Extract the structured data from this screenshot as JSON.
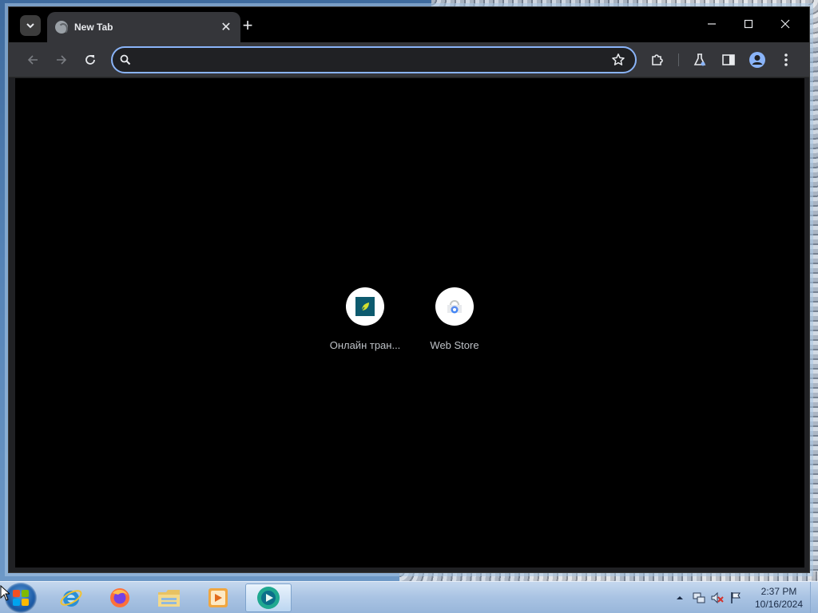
{
  "browser": {
    "tab": {
      "title": "New Tab",
      "close_symbol": "✕"
    },
    "new_tab_symbol": "+",
    "window_controls": {
      "minimize": "—",
      "maximize": "☐",
      "close": "✕"
    },
    "omnibox": {
      "value": "",
      "placeholder": ""
    },
    "shortcuts": [
      {
        "label": "Онлайн тран...",
        "icon": "tile-favicon-icon"
      },
      {
        "label": "Web Store",
        "icon": "web-store-icon"
      }
    ],
    "colors": {
      "frame": "#000000",
      "toolbar": "#35363a",
      "omnibox_focus": "#8ab4f8",
      "content_bg": "#000000"
    }
  },
  "taskbar": {
    "apps": [
      {
        "name": "internet-explorer-icon"
      },
      {
        "name": "firefox-icon"
      },
      {
        "name": "file-explorer-icon"
      },
      {
        "name": "media-player-icon"
      },
      {
        "name": "chrome-icon",
        "active": true
      }
    ],
    "tray": {
      "time": "2:37 PM",
      "date": "10/16/2024"
    }
  }
}
